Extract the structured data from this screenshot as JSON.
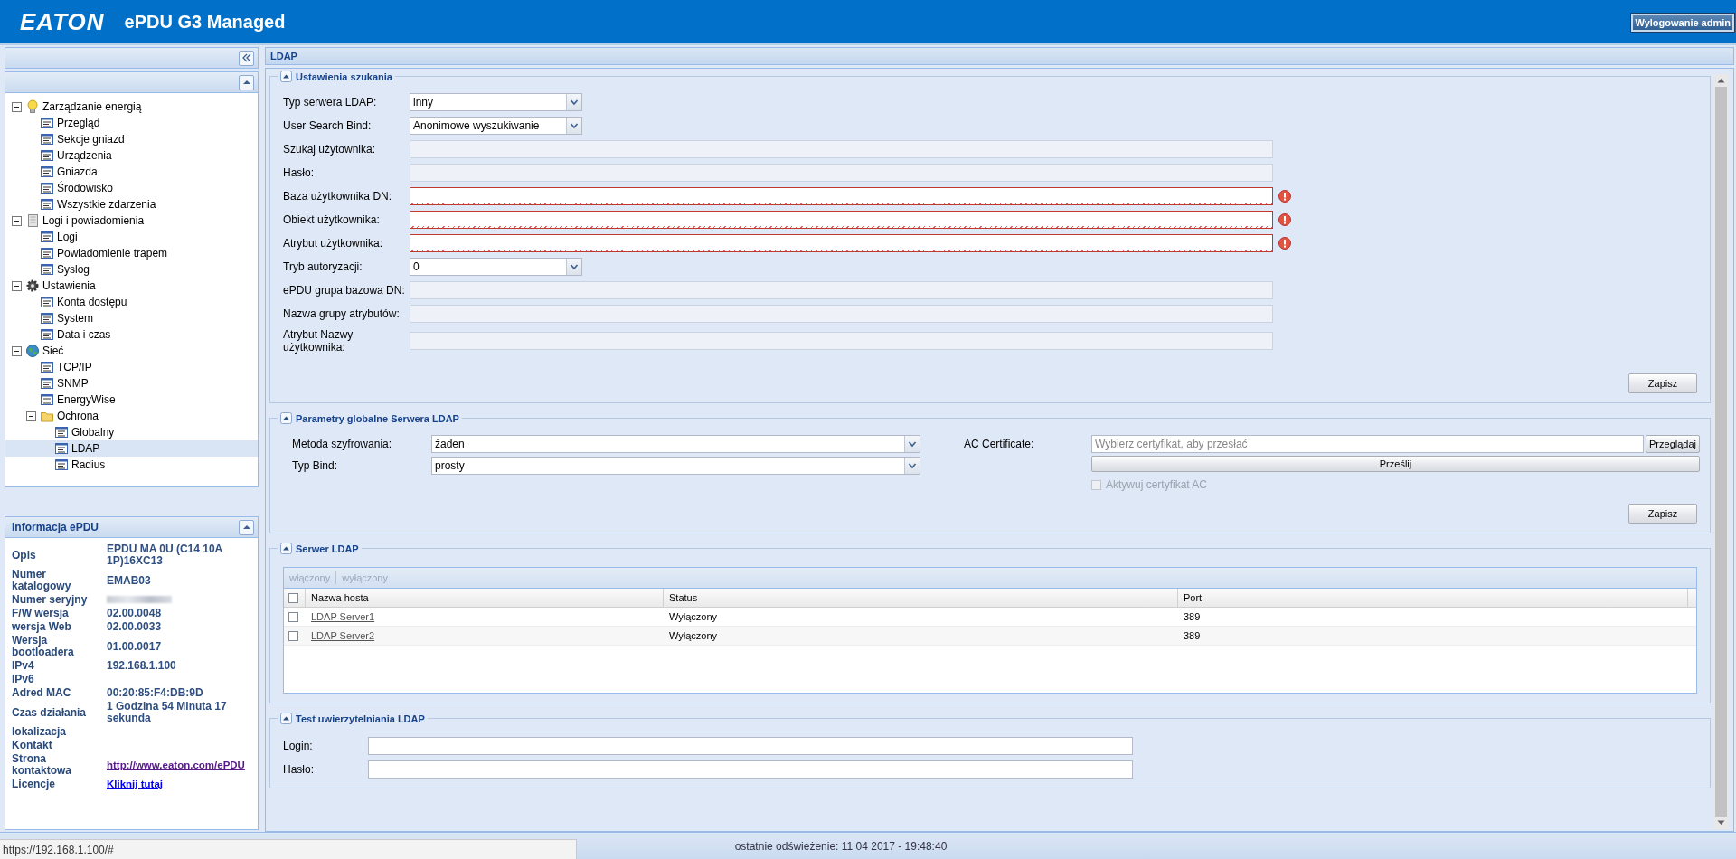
{
  "header": {
    "logo": "EATON",
    "product": "ePDU G3 Managed",
    "logout_button": "Wylogowanie admin"
  },
  "tree": [
    {
      "label": "Zarządzanie energią",
      "kind": "bulb",
      "expanded": true,
      "selected": false,
      "children": [
        {
          "label": "Przegląd",
          "kind": "page",
          "selected": false
        },
        {
          "label": "Sekcje gniazd",
          "kind": "page",
          "selected": false
        },
        {
          "label": "Urządzenia",
          "kind": "page",
          "selected": false
        },
        {
          "label": "Gniazda",
          "kind": "page",
          "selected": false
        },
        {
          "label": "Środowisko",
          "kind": "page",
          "selected": false
        },
        {
          "label": "Wszystkie zdarzenia",
          "kind": "page",
          "selected": false
        }
      ]
    },
    {
      "label": "Logi i powiadomienia",
      "kind": "log",
      "expanded": true,
      "selected": false,
      "children": [
        {
          "label": "Logi",
          "kind": "page",
          "selected": false
        },
        {
          "label": "Powiadomienie trapem",
          "kind": "page",
          "selected": false
        },
        {
          "label": "Syslog",
          "kind": "page",
          "selected": false
        }
      ]
    },
    {
      "label": "Ustawienia",
      "kind": "gear",
      "expanded": true,
      "selected": false,
      "children": [
        {
          "label": "Konta dostępu",
          "kind": "page",
          "selected": false
        },
        {
          "label": "System",
          "kind": "page",
          "selected": false
        },
        {
          "label": "Data i czas",
          "kind": "page",
          "selected": false
        }
      ]
    },
    {
      "label": "Sieć",
      "kind": "globe",
      "expanded": true,
      "selected": false,
      "children": [
        {
          "label": "TCP/IP",
          "kind": "page",
          "selected": false
        },
        {
          "label": "SNMP",
          "kind": "page",
          "selected": false
        },
        {
          "label": "EnergyWise",
          "kind": "page",
          "selected": false
        },
        {
          "label": "Ochrona",
          "kind": "folder",
          "expanded": true,
          "selected": false,
          "children": [
            {
              "label": "Globalny",
              "kind": "page",
              "selected": false
            },
            {
              "label": "LDAP",
              "kind": "page",
              "selected": true
            },
            {
              "label": "Radius",
              "kind": "page",
              "selected": false
            }
          ]
        }
      ]
    }
  ],
  "info": {
    "title": "Informacja ePDU",
    "rows": [
      {
        "label": "Opis",
        "kind": "text",
        "value": "EPDU MA 0U (C14 10A 1P)16XC13"
      },
      {
        "label": "Numer katalogowy",
        "kind": "text",
        "value": "EMAB03"
      },
      {
        "label": "Numer seryjny",
        "kind": "redacted"
      },
      {
        "label": "F/W wersja",
        "kind": "text",
        "value": "02.00.0048"
      },
      {
        "label": "wersja Web",
        "kind": "text",
        "value": "02.00.0033"
      },
      {
        "label": "Wersja bootloadera",
        "kind": "text",
        "value": "01.00.0017"
      },
      {
        "label": "IPv4",
        "kind": "text",
        "value": "192.168.1.100"
      },
      {
        "label": "IPv6",
        "kind": "text"
      },
      {
        "label": "Adred MAC",
        "kind": "text",
        "value": "00:20:85:F4:DB:9D"
      },
      {
        "label": "Czas działania",
        "kind": "text",
        "value": "1 Godzina 54 Minuta 17 sekunda"
      },
      {
        "label": "lokalizacja",
        "kind": "text"
      },
      {
        "label": "Kontakt",
        "kind": "text"
      },
      {
        "label": "Strona kontaktowa",
        "kind": "link",
        "value": "http://www.eaton.com/ePDU",
        "visited": true
      },
      {
        "label": "Licencje",
        "kind": "link",
        "value": "Kliknij tutaj",
        "visited": false
      }
    ]
  },
  "page_title": "LDAP",
  "search_settings": {
    "title": "Ustawienia szukania",
    "expanded": true,
    "fields": [
      {
        "label": "Typ serwera LDAP:",
        "kind": "select",
        "value": "inny"
      },
      {
        "label": "User Search Bind:",
        "kind": "select",
        "value": "Anonimowe wyszukiwanie"
      },
      {
        "label": "Szukaj użytownika:",
        "kind": "text",
        "disabled": true,
        "invalid": false
      },
      {
        "label": "Hasło:",
        "kind": "text",
        "disabled": true,
        "invalid": false
      },
      {
        "label": "Baza użytkownika DN:",
        "kind": "text",
        "disabled": false,
        "invalid": true
      },
      {
        "label": "Obiekt użytkownika:",
        "kind": "text",
        "disabled": false,
        "invalid": true
      },
      {
        "label": "Atrybut użytkownika:",
        "kind": "text",
        "disabled": false,
        "invalid": true
      },
      {
        "label": "Tryb autoryzacji:",
        "kind": "select",
        "value": "0"
      },
      {
        "label": "ePDU grupa bazowa DN:",
        "kind": "text",
        "disabled": true,
        "invalid": false
      },
      {
        "label": "Nazwa grupy atrybutów:",
        "kind": "text",
        "disabled": true,
        "invalid": false
      },
      {
        "label": "Atrybut Nazwy użytkownika:",
        "kind": "text",
        "disabled": true,
        "invalid": false
      }
    ],
    "save_button": "Zapisz"
  },
  "global_params": {
    "title": "Parametry globalne Serwera LDAP",
    "expanded": true,
    "fields": [
      {
        "label": "Metoda szyfrowania:",
        "kind": "select",
        "value": "żaden"
      },
      {
        "label": "Typ Bind:",
        "kind": "select",
        "value": "prosty"
      }
    ],
    "certificate": {
      "label": "AC Certificate:",
      "placeholder": "Wybierz certyfikat, aby przesłać",
      "browse_button": "Przeglądaj",
      "upload_button": "Prześlij",
      "activate": {
        "label": "Aktywuj certyfikat AC",
        "checked": false,
        "disabled": true
      }
    },
    "save_button": "Zapisz"
  },
  "servers": {
    "title": "Serwer LDAP",
    "expanded": true,
    "toolbar": [
      {
        "label": "włączony",
        "disabled": true
      },
      {
        "label": "wyłączony",
        "disabled": true
      }
    ],
    "columns": [
      "Nazwa hosta",
      "Status",
      "Port"
    ],
    "all_checked": false,
    "rows": [
      {
        "host": "LDAP Server1",
        "status": "Wyłączony",
        "port": "389",
        "checked": false
      },
      {
        "host": "LDAP Server2",
        "status": "Wyłączony",
        "port": "389",
        "checked": false
      }
    ]
  },
  "auth_test": {
    "title": "Test uwierzytelniania LDAP",
    "expanded": true,
    "fields": [
      {
        "label": "Login:"
      },
      {
        "label": "Hasło:"
      }
    ]
  },
  "status_bar": {
    "refresh": "ostatnie odświeżenie: 11 04 2017 - 19:48:40"
  },
  "browser_status_url": "https://192.168.1.100/#"
}
